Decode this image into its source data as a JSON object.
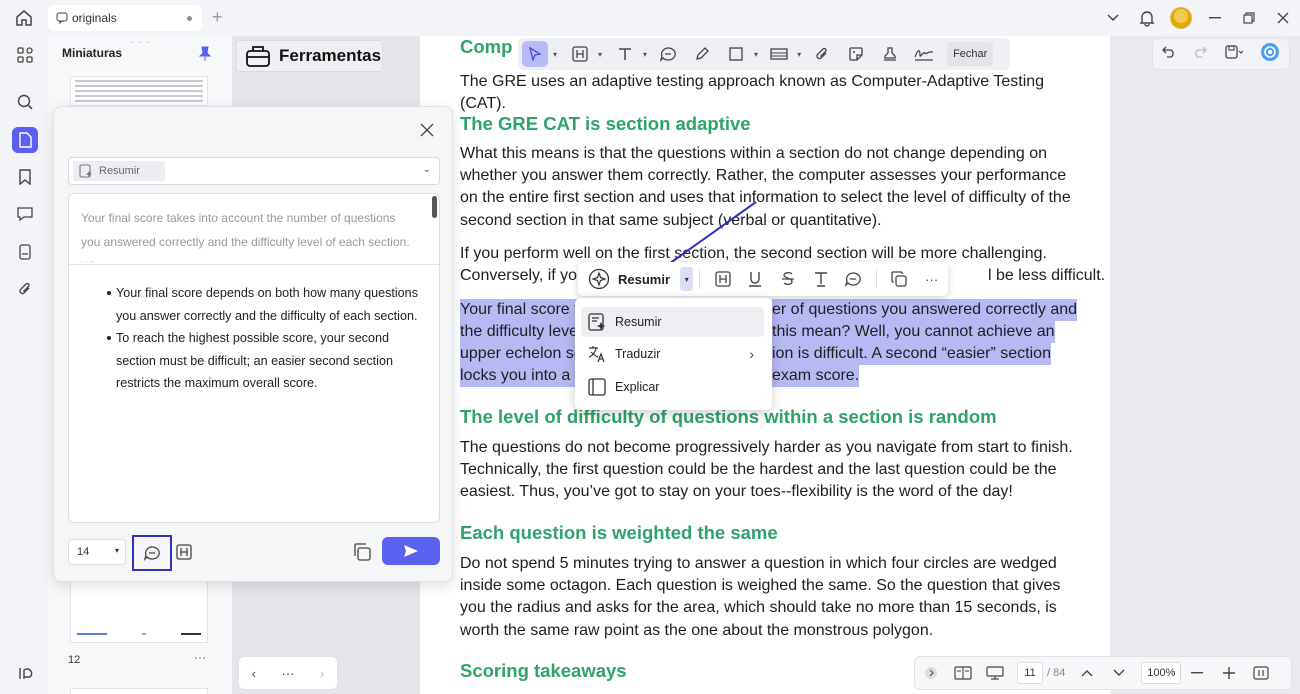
{
  "titlebar": {
    "tab_label": "originals"
  },
  "thumbnails": {
    "title": "Miniaturas",
    "page_number": "12"
  },
  "tools": {
    "title": "Ferramentas"
  },
  "annotation_toolbar": {
    "close_label": "Fechar"
  },
  "document": {
    "heading_partial": "Comp",
    "intro": "The GRE uses an adaptive testing approach known as Computer-Adaptive Testing (CAT).",
    "h_section_adaptive": "The GRE CAT is section adaptive",
    "p1": "What this means is that the questions within a section do not change depending on whether you answer them correctly. Rather, the computer assesses your performance on the entire first section and uses that information to select the level of difficulty of the second section in that same subject (verbal or quantitative).",
    "p2_line1": "If you perform well on the first section, the second section will be more challenging.",
    "p2_line2_start": "Conversely, if you",
    "p2_line2_end": "l be less difficult.",
    "p3_line1_start": "Your final score t",
    "p3_line1_end": "er of questions you answered correctly and",
    "p3_line2_start": "the difficulty leve",
    "p3_line2_end": " this mean? Well, you cannot achieve an",
    "p3_line3_start": "upper echelon sc",
    "p3_line3_end": "ion is difficult. A second “easier” section",
    "p3_line4_start": "locks you into a l",
    "p3_line4_end": "exam score.",
    "h_random": "The level of difficulty of questions within a section is random",
    "p4": "The questions do not become progressively harder as you navigate from start to finish. Technically, the first question could be the hardest and the last question could be the easiest. Thus, you’ve got to stay on your toes--flexibility is the word of the day!",
    "h_weighted": "Each question is weighted the same",
    "p5": "Do not spend 5 minutes trying to answer a question in which four circles are wedged inside some octagon. Each question is weighed the same. So the question that gives you the radius and asks for the area, which should take no more than 15 seconds, is worth the same raw point as the one about the monstrous polygon.",
    "h_takeaways": "Scoring takeaways"
  },
  "float_toolbar": {
    "resumir_label": "Resumir",
    "more": "···"
  },
  "ai_menu": {
    "items": [
      {
        "label": "Resumir"
      },
      {
        "label": "Traduzir"
      },
      {
        "label": "Explicar"
      }
    ]
  },
  "ai_dialog": {
    "mode_label": "Resumir",
    "quote": "Your final score takes into account the number of questions you answered correctly and the difficulty level of each section. What",
    "bullets": [
      "Your final score depends on both how many questions you answer correctly and the difficulty of each section.",
      "To reach the highest possible score, your second section must be difficult; an easier second section restricts the maximum overall score."
    ],
    "font_size": "14"
  },
  "status_bar": {
    "current_page": "11",
    "total_pages": "/ 84",
    "zoom": "100%"
  },
  "bottom_nav": {
    "more": "···"
  },
  "colors": {
    "accent": "#5b5ff3",
    "heading_green": "#2ea36a",
    "highlight": "#b7b9f5"
  }
}
